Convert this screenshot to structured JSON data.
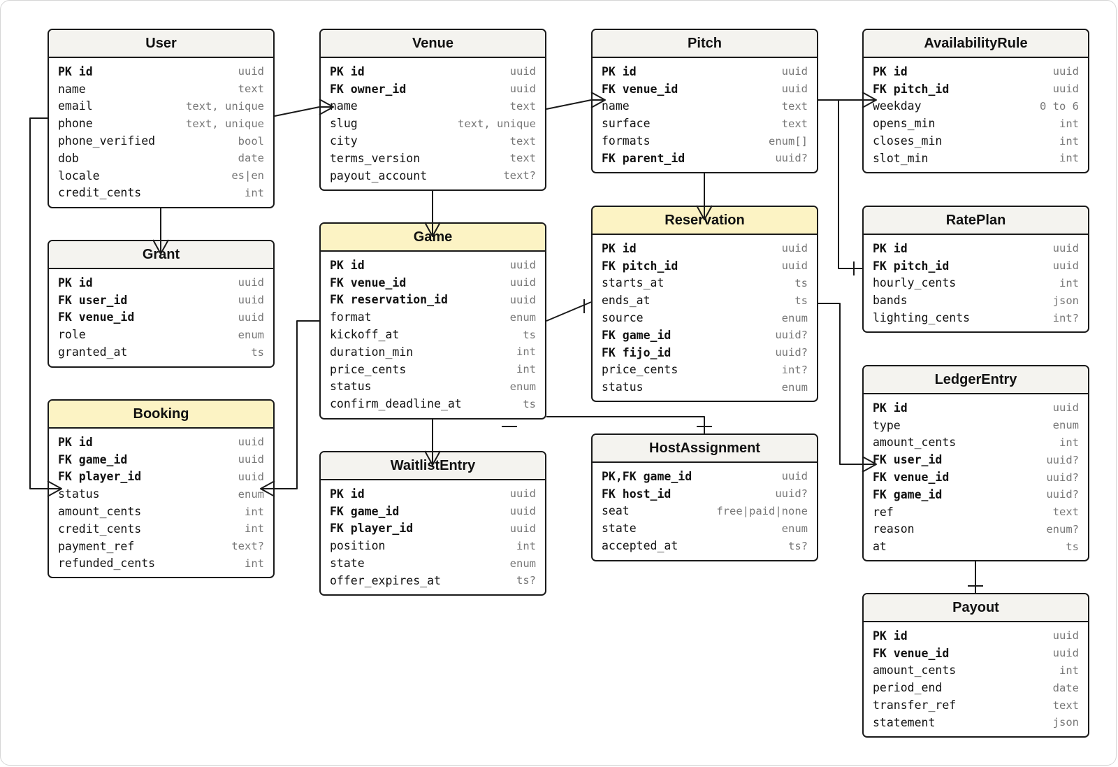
{
  "diagram_type": "entity-relationship",
  "entities": {
    "user": {
      "title": "User",
      "highlight": false,
      "fields": [
        {
          "name": "PK id",
          "type": "uuid",
          "key": true
        },
        {
          "name": "name",
          "type": "text",
          "key": false
        },
        {
          "name": "email",
          "type": "text, unique",
          "key": false
        },
        {
          "name": "phone",
          "type": "text, unique",
          "key": false
        },
        {
          "name": "phone_verified",
          "type": "bool",
          "key": false
        },
        {
          "name": "dob",
          "type": "date",
          "key": false
        },
        {
          "name": "locale",
          "type": "es|en",
          "key": false
        },
        {
          "name": "credit_cents",
          "type": "int",
          "key": false
        }
      ]
    },
    "venue": {
      "title": "Venue",
      "highlight": false,
      "fields": [
        {
          "name": "PK id",
          "type": "uuid",
          "key": true
        },
        {
          "name": "FK owner_id",
          "type": "uuid",
          "key": true
        },
        {
          "name": "name",
          "type": "text",
          "key": false
        },
        {
          "name": "slug",
          "type": "text, unique",
          "key": false
        },
        {
          "name": "city",
          "type": "text",
          "key": false
        },
        {
          "name": "terms_version",
          "type": "text",
          "key": false
        },
        {
          "name": "payout_account",
          "type": "text?",
          "key": false
        }
      ]
    },
    "pitch": {
      "title": "Pitch",
      "highlight": false,
      "fields": [
        {
          "name": "PK id",
          "type": "uuid",
          "key": true
        },
        {
          "name": "FK venue_id",
          "type": "uuid",
          "key": true
        },
        {
          "name": "name",
          "type": "text",
          "key": false
        },
        {
          "name": "surface",
          "type": "text",
          "key": false
        },
        {
          "name": "formats",
          "type": "enum[]",
          "key": false
        },
        {
          "name": "FK parent_id",
          "type": "uuid?",
          "key": true
        }
      ]
    },
    "availabilityrule": {
      "title": "AvailabilityRule",
      "highlight": false,
      "fields": [
        {
          "name": "PK id",
          "type": "uuid",
          "key": true
        },
        {
          "name": "FK pitch_id",
          "type": "uuid",
          "key": true
        },
        {
          "name": "weekday",
          "type": "0 to 6",
          "key": false
        },
        {
          "name": "opens_min",
          "type": "int",
          "key": false
        },
        {
          "name": "closes_min",
          "type": "int",
          "key": false
        },
        {
          "name": "slot_min",
          "type": "int",
          "key": false
        }
      ]
    },
    "grant": {
      "title": "Grant",
      "highlight": false,
      "fields": [
        {
          "name": "PK id",
          "type": "uuid",
          "key": true
        },
        {
          "name": "FK user_id",
          "type": "uuid",
          "key": true
        },
        {
          "name": "FK venue_id",
          "type": "uuid",
          "key": true
        },
        {
          "name": "role",
          "type": "enum",
          "key": false
        },
        {
          "name": "granted_at",
          "type": "ts",
          "key": false
        }
      ]
    },
    "game": {
      "title": "Game",
      "highlight": true,
      "fields": [
        {
          "name": "PK id",
          "type": "uuid",
          "key": true
        },
        {
          "name": "FK venue_id",
          "type": "uuid",
          "key": true
        },
        {
          "name": "FK reservation_id",
          "type": "uuid",
          "key": true
        },
        {
          "name": "format",
          "type": "enum",
          "key": false
        },
        {
          "name": "kickoff_at",
          "type": "ts",
          "key": false
        },
        {
          "name": "duration_min",
          "type": "int",
          "key": false
        },
        {
          "name": "price_cents",
          "type": "int",
          "key": false
        },
        {
          "name": "status",
          "type": "enum",
          "key": false
        },
        {
          "name": "confirm_deadline_at",
          "type": "ts",
          "key": false
        }
      ]
    },
    "reservation": {
      "title": "Reservation",
      "highlight": true,
      "fields": [
        {
          "name": "PK id",
          "type": "uuid",
          "key": true
        },
        {
          "name": "FK pitch_id",
          "type": "uuid",
          "key": true
        },
        {
          "name": "starts_at",
          "type": "ts",
          "key": false
        },
        {
          "name": "ends_at",
          "type": "ts",
          "key": false
        },
        {
          "name": "source",
          "type": "enum",
          "key": false
        },
        {
          "name": "FK game_id",
          "type": "uuid?",
          "key": true
        },
        {
          "name": "FK fijo_id",
          "type": "uuid?",
          "key": true
        },
        {
          "name": "price_cents",
          "type": "int?",
          "key": false
        },
        {
          "name": "status",
          "type": "enum",
          "key": false
        }
      ]
    },
    "rateplan": {
      "title": "RatePlan",
      "highlight": false,
      "fields": [
        {
          "name": "PK id",
          "type": "uuid",
          "key": true
        },
        {
          "name": "FK pitch_id",
          "type": "uuid",
          "key": true
        },
        {
          "name": "hourly_cents",
          "type": "int",
          "key": false
        },
        {
          "name": "bands",
          "type": "json",
          "key": false
        },
        {
          "name": "lighting_cents",
          "type": "int?",
          "key": false
        }
      ]
    },
    "booking": {
      "title": "Booking",
      "highlight": true,
      "fields": [
        {
          "name": "PK id",
          "type": "uuid",
          "key": true
        },
        {
          "name": "FK game_id",
          "type": "uuid",
          "key": true
        },
        {
          "name": "FK player_id",
          "type": "uuid",
          "key": true
        },
        {
          "name": "status",
          "type": "enum",
          "key": false
        },
        {
          "name": "amount_cents",
          "type": "int",
          "key": false
        },
        {
          "name": "credit_cents",
          "type": "int",
          "key": false
        },
        {
          "name": "payment_ref",
          "type": "text?",
          "key": false
        },
        {
          "name": "refunded_cents",
          "type": "int",
          "key": false
        }
      ]
    },
    "ledgerentry": {
      "title": "LedgerEntry",
      "highlight": false,
      "fields": [
        {
          "name": "PK id",
          "type": "uuid",
          "key": true
        },
        {
          "name": "type",
          "type": "enum",
          "key": false
        },
        {
          "name": "amount_cents",
          "type": "int",
          "key": false
        },
        {
          "name": "FK user_id",
          "type": "uuid?",
          "key": true
        },
        {
          "name": "FK venue_id",
          "type": "uuid?",
          "key": true
        },
        {
          "name": "FK game_id",
          "type": "uuid?",
          "key": true
        },
        {
          "name": "ref",
          "type": "text",
          "key": false
        },
        {
          "name": "reason",
          "type": "enum?",
          "key": false
        },
        {
          "name": "at",
          "type": "ts",
          "key": false
        }
      ]
    },
    "waitlistentry": {
      "title": "WaitlistEntry",
      "highlight": false,
      "fields": [
        {
          "name": "PK id",
          "type": "uuid",
          "key": true
        },
        {
          "name": "FK game_id",
          "type": "uuid",
          "key": true
        },
        {
          "name": "FK player_id",
          "type": "uuid",
          "key": true
        },
        {
          "name": "position",
          "type": "int",
          "key": false
        },
        {
          "name": "state",
          "type": "enum",
          "key": false
        },
        {
          "name": "offer_expires_at",
          "type": "ts?",
          "key": false
        }
      ]
    },
    "hostassignment": {
      "title": "HostAssignment",
      "highlight": false,
      "fields": [
        {
          "name": "PK,FK game_id",
          "type": "uuid",
          "key": true
        },
        {
          "name": "FK host_id",
          "type": "uuid?",
          "key": true
        },
        {
          "name": "seat",
          "type": "free|paid|none",
          "key": false
        },
        {
          "name": "state",
          "type": "enum",
          "key": false
        },
        {
          "name": "accepted_at",
          "type": "ts?",
          "key": false
        }
      ]
    },
    "payout": {
      "title": "Payout",
      "highlight": false,
      "fields": [
        {
          "name": "PK id",
          "type": "uuid",
          "key": true
        },
        {
          "name": "FK venue_id",
          "type": "uuid",
          "key": true
        },
        {
          "name": "amount_cents",
          "type": "int",
          "key": false
        },
        {
          "name": "period_end",
          "type": "date",
          "key": false
        },
        {
          "name": "transfer_ref",
          "type": "text",
          "key": false
        },
        {
          "name": "statement",
          "type": "json",
          "key": false
        }
      ]
    }
  },
  "relationships": [
    {
      "from": "user",
      "to": "venue",
      "from_end": "one",
      "to_end": "many"
    },
    {
      "from": "venue",
      "to": "pitch",
      "from_end": "one",
      "to_end": "many"
    },
    {
      "from": "pitch",
      "to": "availabilityrule",
      "from_end": "one",
      "to_end": "many"
    },
    {
      "from": "pitch",
      "to": "rateplan",
      "from_end": "one",
      "to_end": "one"
    },
    {
      "from": "pitch",
      "to": "reservation",
      "from_end": "one",
      "to_end": "many"
    },
    {
      "from": "user",
      "to": "grant",
      "from_end": "one",
      "to_end": "many"
    },
    {
      "from": "venue",
      "to": "game",
      "from_end": "one",
      "to_end": "many"
    },
    {
      "from": "game",
      "to": "reservation",
      "from_end": "one",
      "to_end": "one"
    },
    {
      "from": "game",
      "to": "booking",
      "from_end": "one",
      "to_end": "many"
    },
    {
      "from": "user",
      "to": "booking",
      "from_end": "one",
      "to_end": "many"
    },
    {
      "from": "game",
      "to": "waitlistentry",
      "from_end": "one",
      "to_end": "many"
    },
    {
      "from": "game",
      "to": "hostassignment",
      "from_end": "one",
      "to_end": "one"
    },
    {
      "from": "reservation",
      "to": "ledgerentry",
      "from_end": "one",
      "to_end": "many"
    },
    {
      "from": "ledgerentry",
      "to": "payout",
      "from_end": "one",
      "to_end": "one"
    }
  ]
}
